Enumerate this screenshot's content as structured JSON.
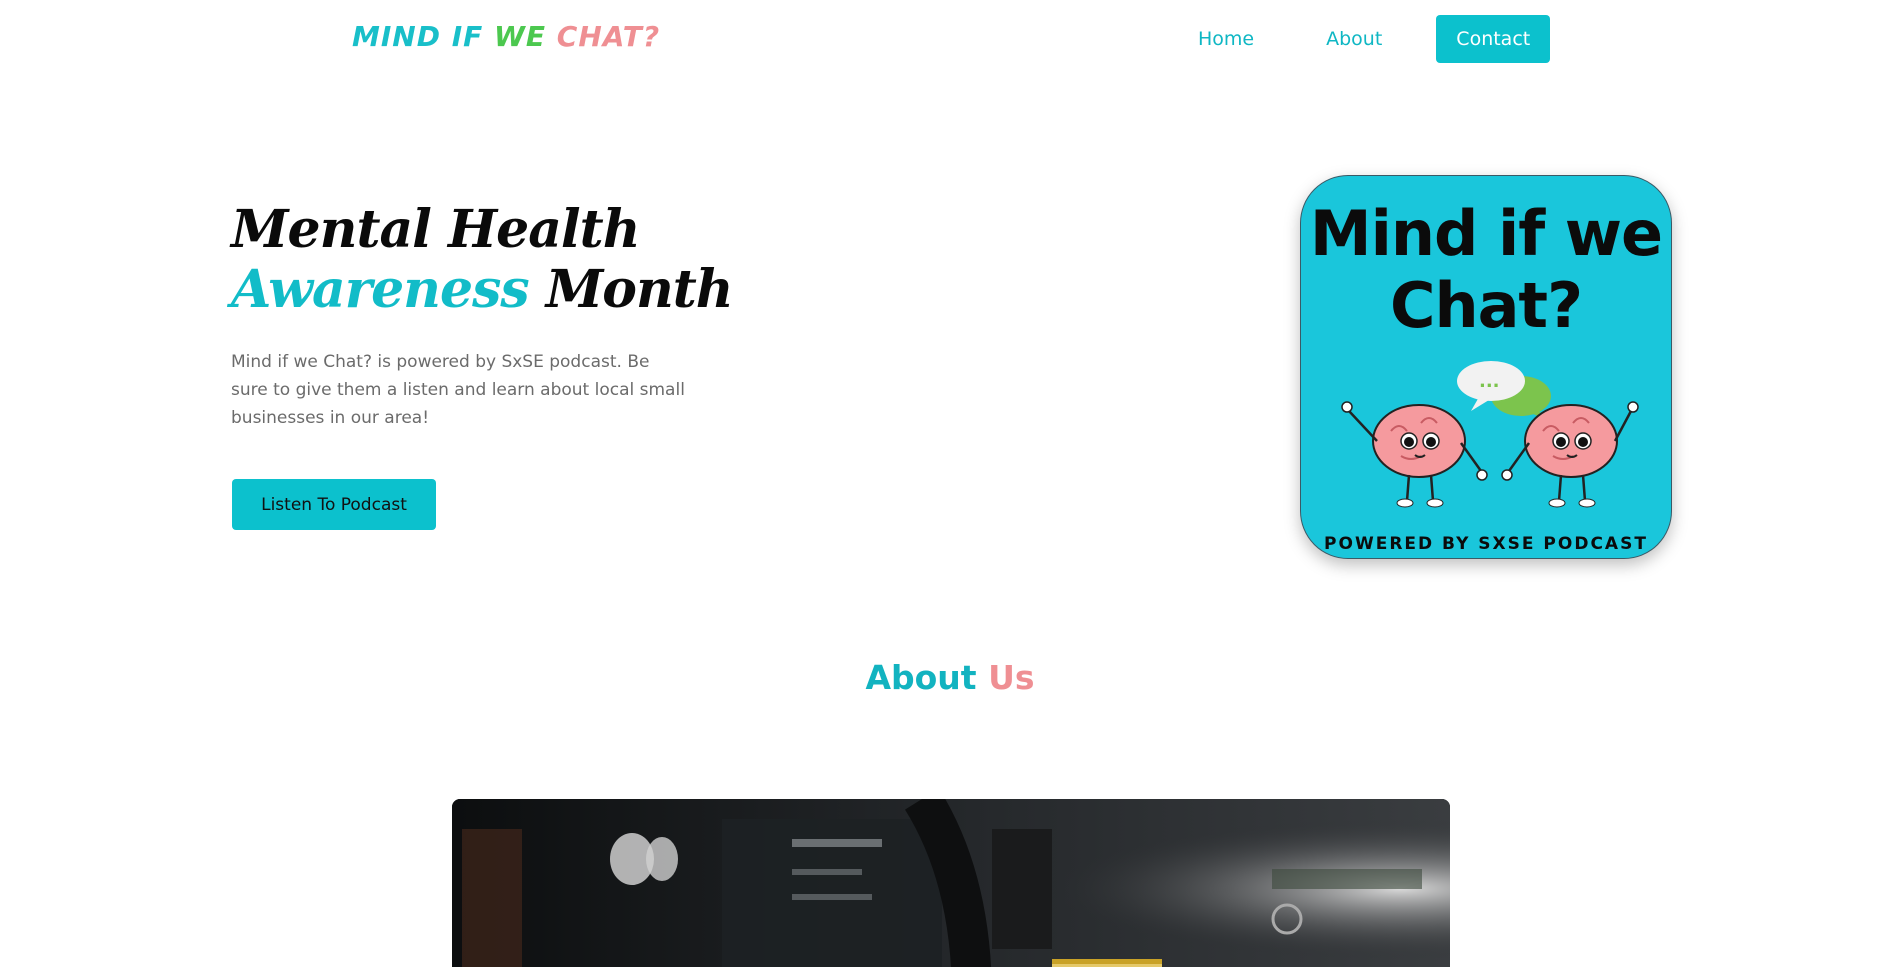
{
  "nav": {
    "logo_part1": "MIND IF",
    "logo_part2": "WE",
    "logo_part3": "CHAT?",
    "links": [
      {
        "label": "Home"
      },
      {
        "label": "About"
      },
      {
        "label": "Contact"
      }
    ]
  },
  "hero": {
    "title_line1": "Mental Health",
    "title_accent": "Awareness",
    "title_end": "Month",
    "text": "Mind if we Chat? is powered by SxSE podcast. Be sure to give them a listen and learn about local small businesses in our area!",
    "button_label": "Listen To Podcast"
  },
  "cover": {
    "title": "Mind if we Chat?",
    "bubble_text": "...",
    "footer": "POWERED BY SXSE PODCAST"
  },
  "about": {
    "title_part1": "About",
    "title_part2": "Us"
  },
  "colors": {
    "accent": "#0cc1cd",
    "logo_green": "#4cc84f",
    "pink": "#ef8f93"
  }
}
